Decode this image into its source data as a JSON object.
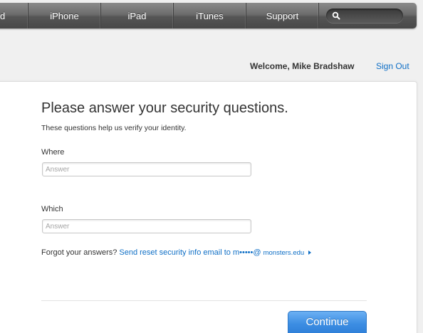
{
  "nav": {
    "items": [
      "d",
      "iPhone",
      "iPad",
      "iTunes",
      "Support"
    ],
    "search_icon": "magnifier-icon"
  },
  "header": {
    "welcome": "Welcome, Mike Bradshaw",
    "signout": "Sign Out"
  },
  "form": {
    "title": "Please answer your security questions.",
    "subtitle": "These questions help us verify your identity.",
    "questions": [
      {
        "label": "Where",
        "placeholder": "Answer",
        "value": ""
      },
      {
        "label": "Which",
        "placeholder": "Answer",
        "value": ""
      }
    ],
    "forgot_prefix": "Forgot your answers?",
    "forgot_link": "Send reset security info email to m•••••@ ",
    "forgot_domain": "monsters.edu",
    "continue_label": "Continue"
  },
  "colors": {
    "link": "#0f6fc6",
    "button": "#3d8ee3",
    "nav": "#6c6c6c"
  }
}
